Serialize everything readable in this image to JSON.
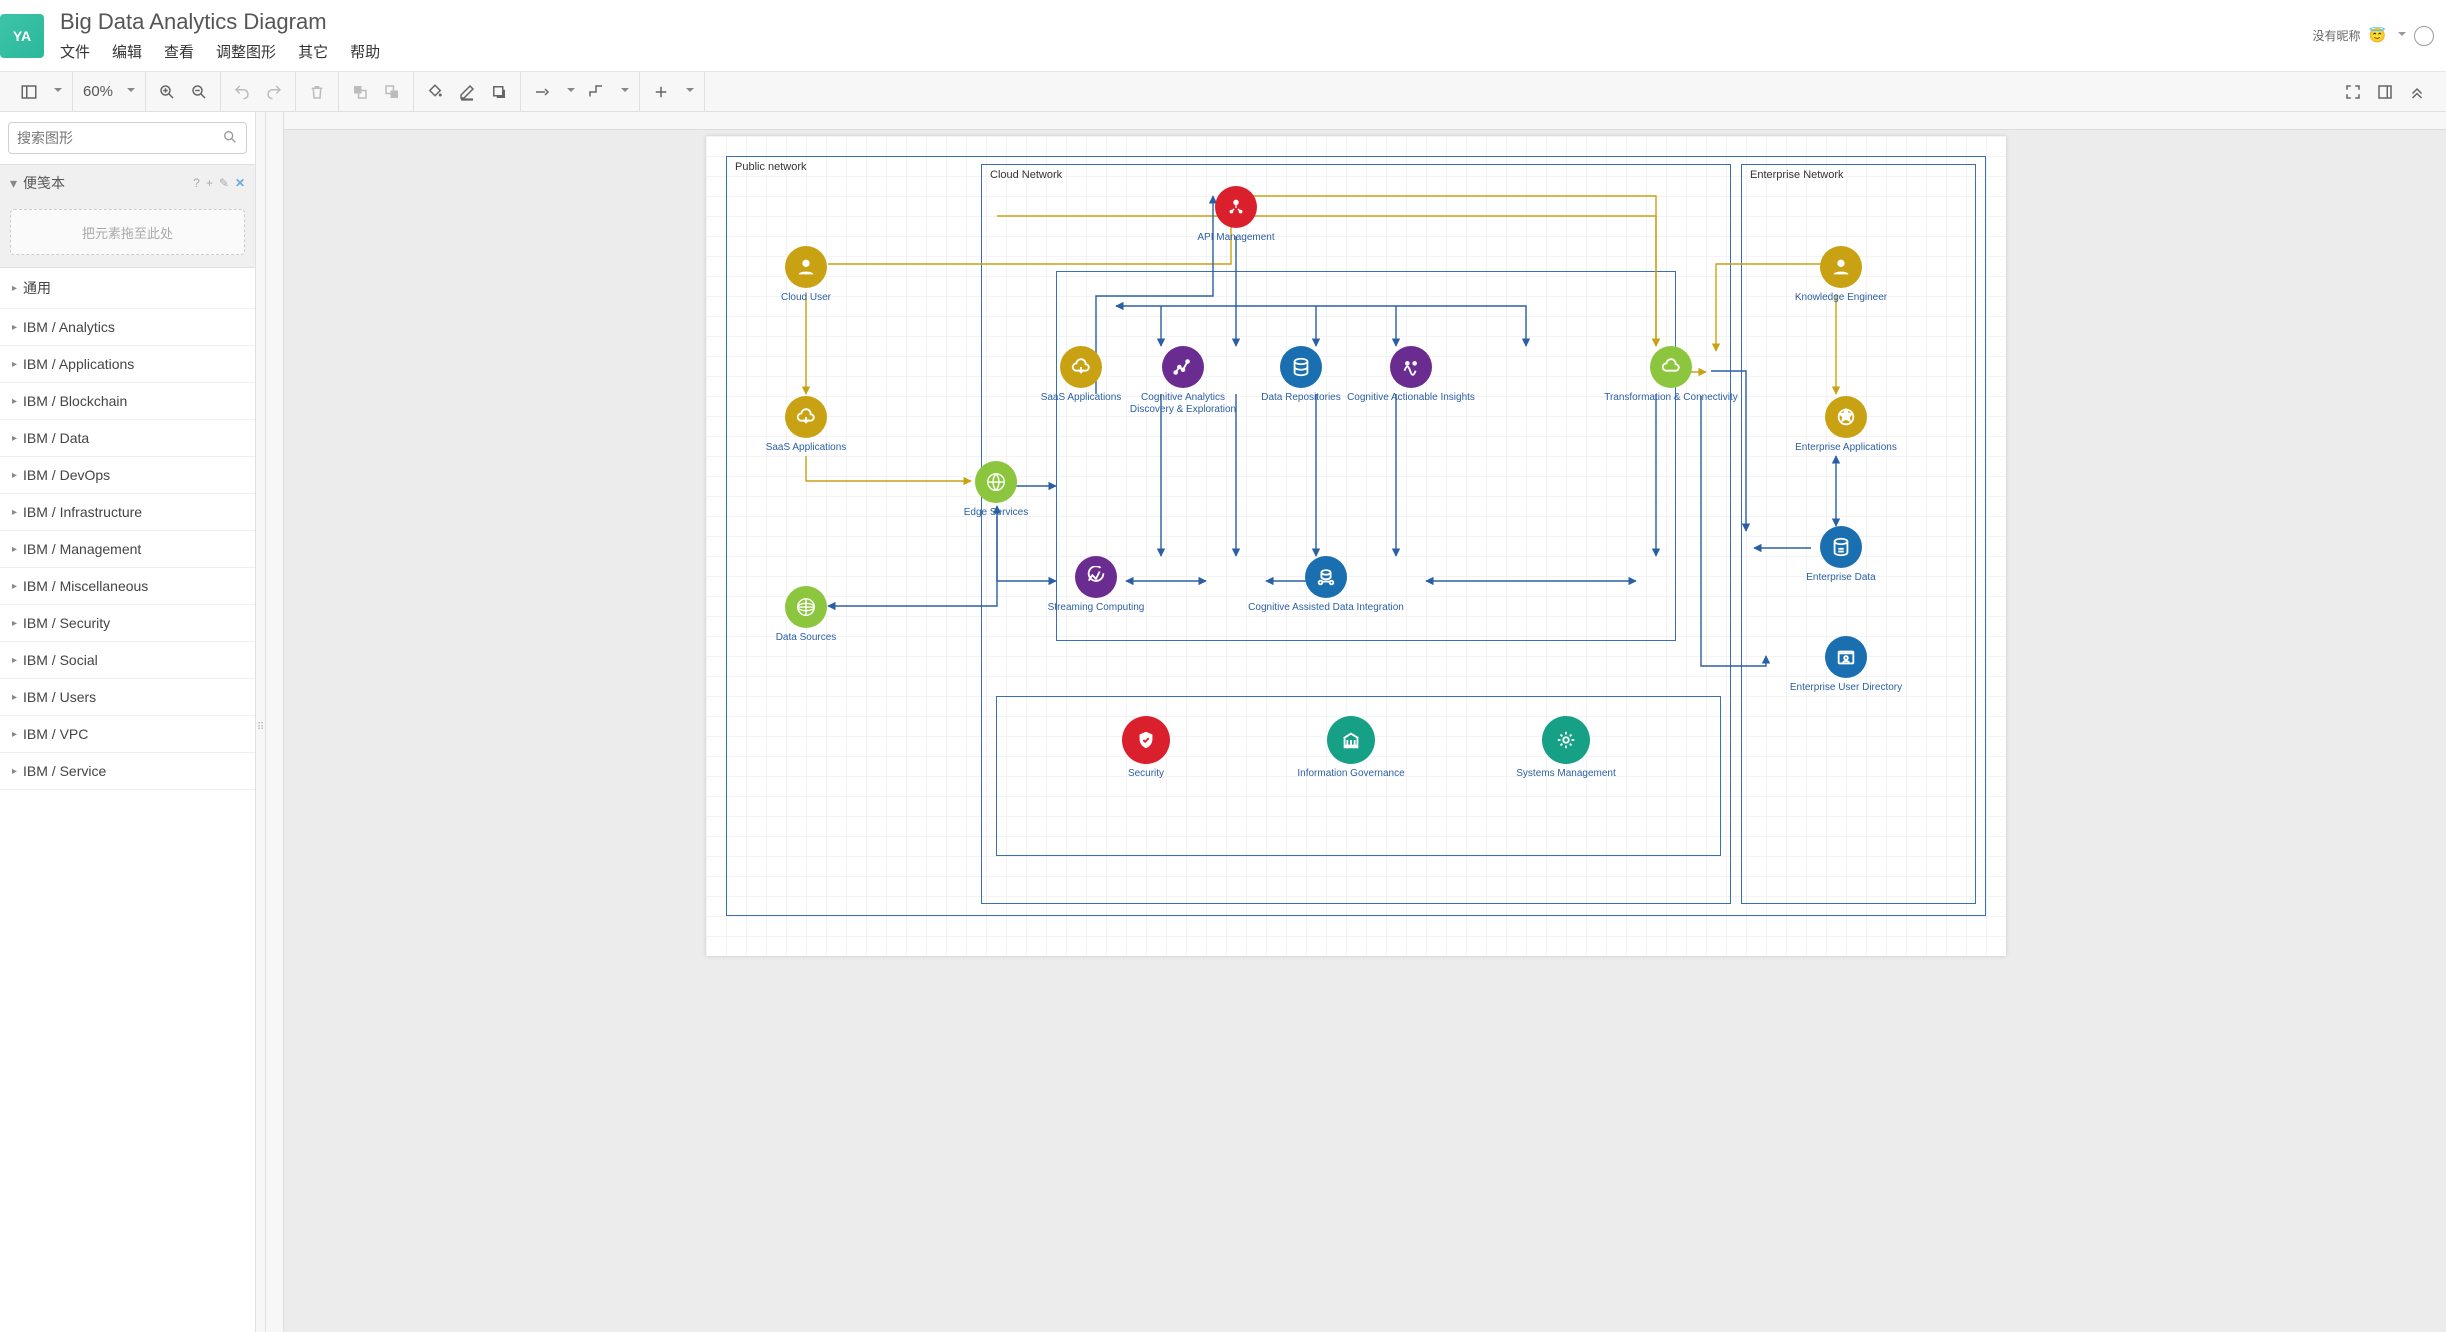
{
  "header": {
    "logo_text": "YA",
    "title": "Big Data Analytics Diagram",
    "menus": [
      "文件",
      "编辑",
      "查看",
      "调整图形",
      "其它",
      "帮助"
    ],
    "user_label": "没有昵称"
  },
  "toolbar": {
    "zoom": "60%"
  },
  "sidebar": {
    "search_placeholder": "搜索图形",
    "scratch_title": "便笺本",
    "drop_hint": "把元素拖至此处",
    "categories": [
      "通用",
      "IBM / Analytics",
      "IBM / Applications",
      "IBM / Blockchain",
      "IBM / Data",
      "IBM / DevOps",
      "IBM / Infrastructure",
      "IBM / Management",
      "IBM / Miscellaneous",
      "IBM / Security",
      "IBM / Social",
      "IBM / Users",
      "IBM / VPC",
      "IBM / Service"
    ]
  },
  "diagram": {
    "regions": {
      "public": {
        "label": "Public network"
      },
      "cloud": {
        "label": "Cloud Network"
      },
      "enterprise": {
        "label": "Enterprise Network"
      }
    },
    "nodes": {
      "cloud_user": {
        "label": "Cloud User"
      },
      "saas_apps_pub": {
        "label": "SaaS Applications"
      },
      "data_sources": {
        "label": "Data Sources"
      },
      "api_mgmt": {
        "label": "API Management"
      },
      "edge": {
        "label": "Edge Services"
      },
      "saas_apps_cloud": {
        "label": "SaaS Applications"
      },
      "cog_analytics": {
        "label": "Cognitive Analytics Discovery & Exploration"
      },
      "data_repos": {
        "label": "Data Repositories"
      },
      "cog_insights": {
        "label": "Cognitive Actionable Insights"
      },
      "transform": {
        "label": "Transformation & Connectivity"
      },
      "streaming": {
        "label": "Streaming Computing"
      },
      "cog_dataint": {
        "label": "Cognitive Assisted Data Integration"
      },
      "security": {
        "label": "Security"
      },
      "info_gov": {
        "label": "Information Governance"
      },
      "sys_mgmt": {
        "label": "Systems Management"
      },
      "knowledge_eng": {
        "label": "Knowledge Engineer"
      },
      "ent_apps": {
        "label": "Enterprise Applications"
      },
      "ent_data": {
        "label": "Enterprise Data"
      },
      "ent_userdir": {
        "label": "Enterprise User Directory"
      }
    }
  }
}
